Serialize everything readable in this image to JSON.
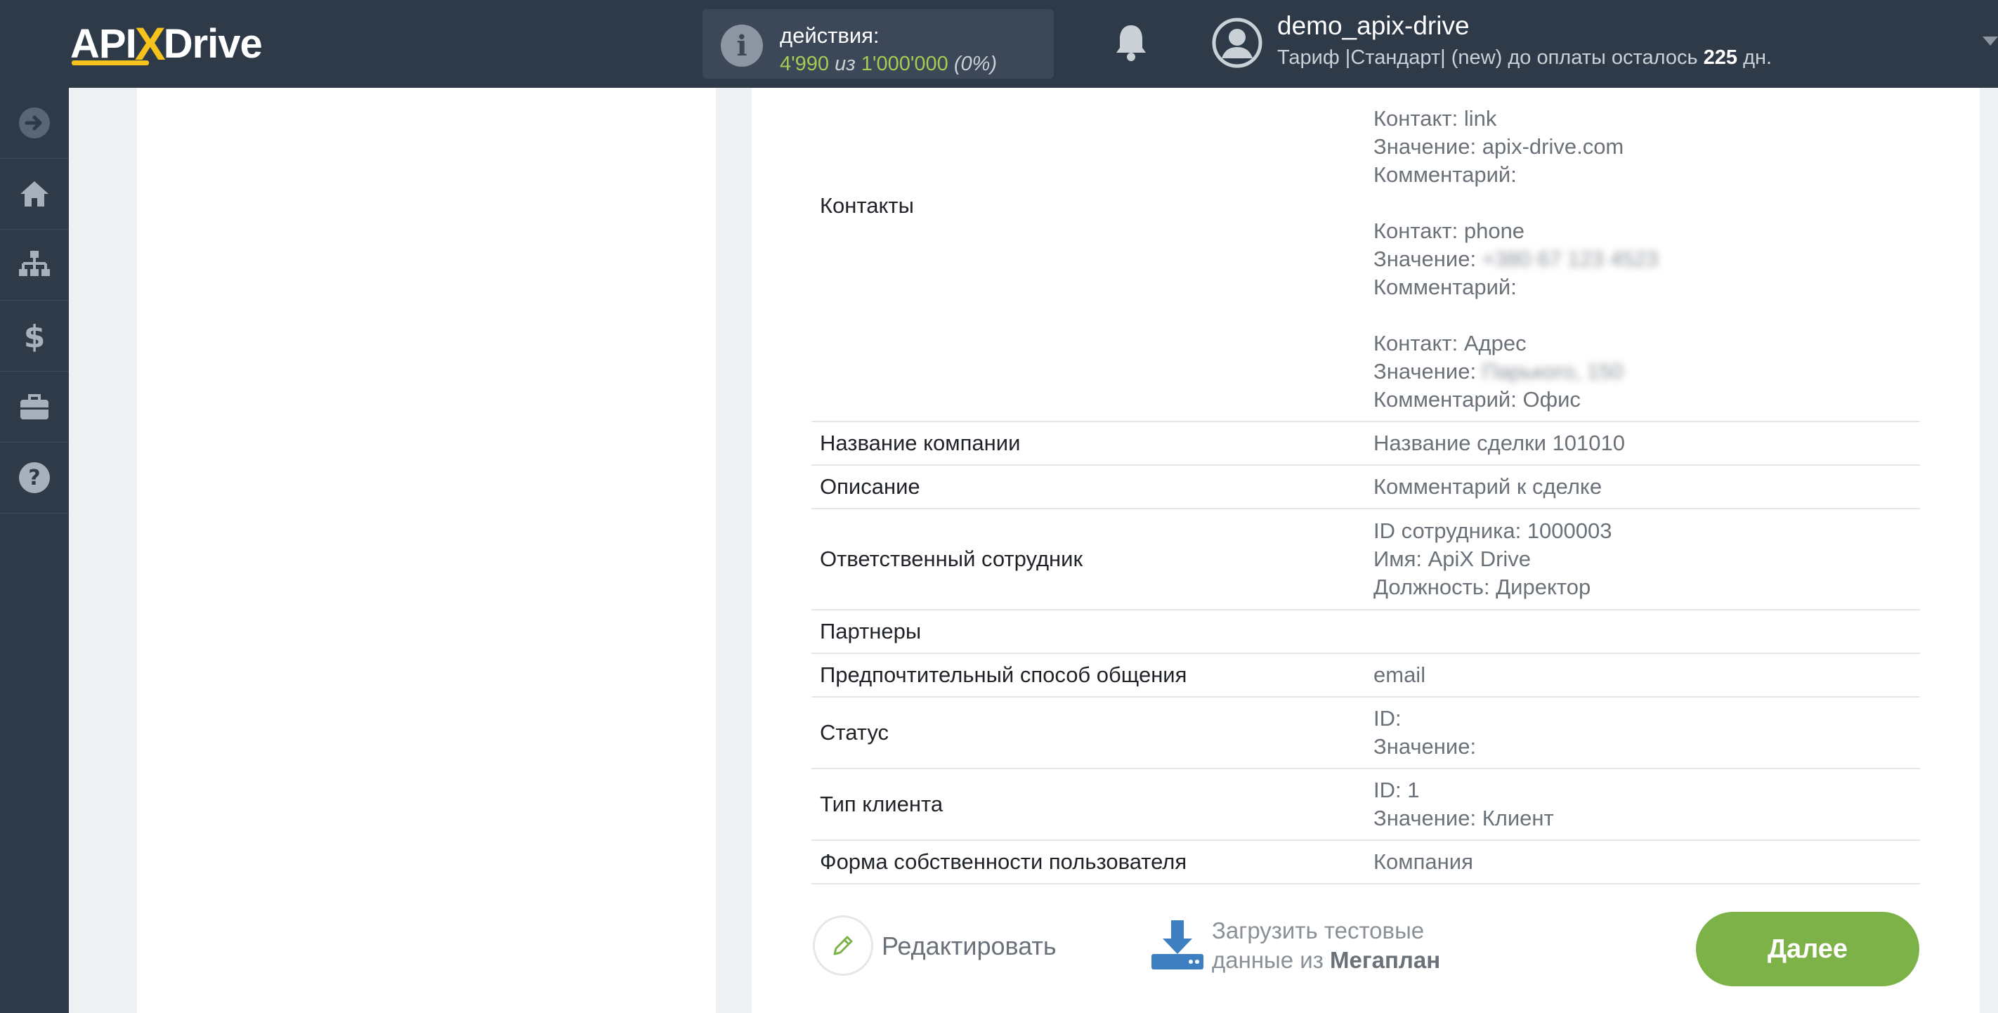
{
  "header": {
    "logo": {
      "part1": "API",
      "part2": "X",
      "part3": "Drive"
    },
    "actions": {
      "label": "действия:",
      "used": "4'990",
      "of": "из",
      "total": "1'000'000",
      "percent": "(0%)"
    },
    "user": {
      "name": "demo_apix-drive",
      "tariff_prefix": "Тариф |Стандарт| (new) до оплаты осталось",
      "days": "225",
      "days_suffix": "дн."
    }
  },
  "sidebar": {
    "items": [
      {
        "icon": "arrow-right-circle-icon"
      },
      {
        "icon": "home-icon"
      },
      {
        "icon": "sitemap-icon"
      },
      {
        "icon": "dollar-icon"
      },
      {
        "icon": "briefcase-icon"
      },
      {
        "icon": "help-icon"
      }
    ]
  },
  "table": {
    "rows": [
      {
        "key": "Контакты",
        "values": [
          "Контакт: link",
          "Значение: apix-drive.com",
          "Комментарий:",
          "",
          "Контакт: phone",
          "Значение:",
          "Комментарий:",
          "",
          "Контакт: Адрес",
          "Значение:",
          "Комментарий: Офис"
        ]
      },
      {
        "key": "Название компании",
        "values": [
          "Название сделки 101010"
        ]
      },
      {
        "key": "Описание",
        "values": [
          "Комментарий к сделке"
        ]
      },
      {
        "key": "Ответственный сотрудник",
        "values": [
          "ID сотрудника: 1000003",
          "Имя: ApiX Drive",
          "Должность: Директор"
        ]
      },
      {
        "key": "Партнеры",
        "values": [
          ""
        ]
      },
      {
        "key": "Предпочтительный способ общения",
        "values": [
          "email"
        ]
      },
      {
        "key": "Статус",
        "values": [
          "ID:",
          "Значение:"
        ]
      },
      {
        "key": "Тип клиента",
        "values": [
          "ID: 1",
          "Значение: Клиент"
        ]
      },
      {
        "key": "Форма собственности пользователя",
        "values": [
          "Компания"
        ]
      }
    ],
    "blurred": {
      "phone": "+380 67 123 4523",
      "address": "Парького, 150"
    }
  },
  "footer": {
    "edit_label": "Редактировать",
    "download_line1": "Загрузить тестовые",
    "download_line2_prefix": "данные из",
    "download_line2_bold": "Мегаплан",
    "next_label": "Далее"
  },
  "colors": {
    "topbar": "#2e3a48",
    "accent_green": "#7cb247",
    "logo_yellow": "#f6c31d"
  }
}
